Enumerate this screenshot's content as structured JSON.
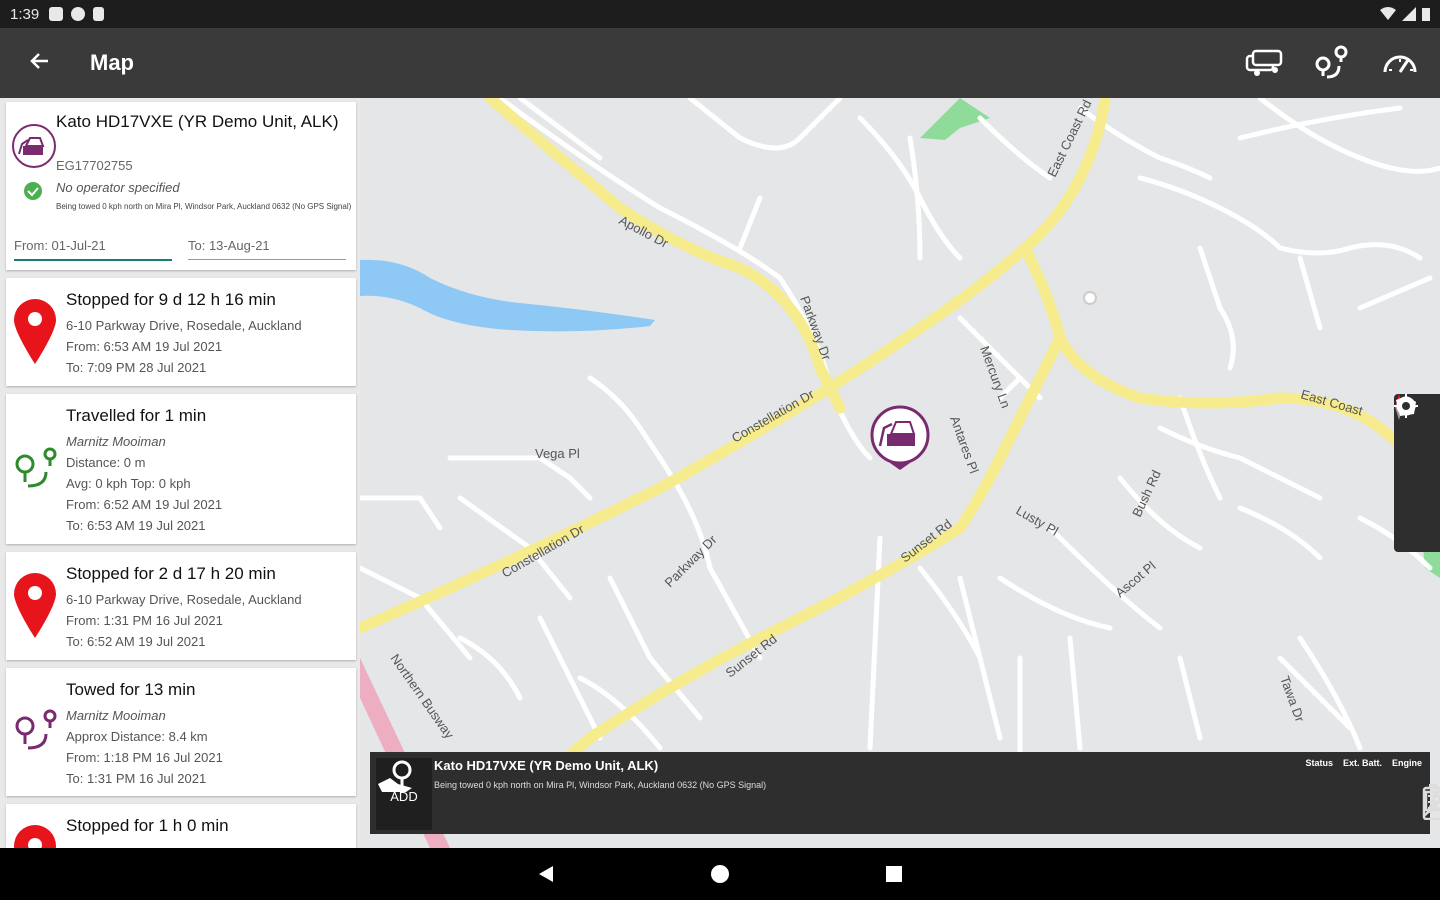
{
  "status_bar": {
    "time": "1:39",
    "icons": [
      "notification-icon",
      "chat-icon",
      "sd-card-icon",
      "wifi-icon",
      "signal-icon",
      "battery-icon"
    ]
  },
  "app_bar": {
    "title": "Map",
    "actions": [
      "vehicles-icon",
      "route-icon",
      "dashboard-icon"
    ]
  },
  "asset": {
    "name": "Kato HD17VXE (YR Demo Unit, ALK)",
    "serial": "EG17702755",
    "operator": "No operator specified",
    "location": "Being towed 0 kph north on Mira Pl, Windsor Park, Auckland 0632 (No GPS Signal)",
    "from": "From: 01-Jul-21",
    "to": "To: 13-Aug-21"
  },
  "trips": [
    {
      "type": "stopped",
      "title": "Stopped for 9 d 12 h 16 min",
      "lines": [
        "6-10 Parkway Drive, Rosedale, Auckland",
        "From:  6:53 AM 19 Jul 2021",
        "To:      7:09 PM 28 Jul 2021"
      ]
    },
    {
      "type": "travelled",
      "title": "Travelled for 1 min",
      "lines": [
        "Marnitz Mooiman",
        "Distance: 0 m",
        "Avg: 0 kph  Top: 0 kph",
        "From:  6:52 AM 19 Jul 2021",
        "To:      6:53 AM 19 Jul 2021"
      ]
    },
    {
      "type": "stopped",
      "title": "Stopped for 2 d 17 h 20 min",
      "lines": [
        "6-10 Parkway Drive, Rosedale, Auckland",
        "From:  1:31 PM 16 Jul 2021",
        "To:      6:52 AM 19 Jul 2021"
      ]
    },
    {
      "type": "towed",
      "title": "Towed for 13 min",
      "lines": [
        "Marnitz Mooiman",
        "Approx Distance: 8.4 km",
        "From:  1:18 PM 16 Jul 2021",
        "To:      1:31 PM 16 Jul 2021"
      ]
    },
    {
      "type": "stopped",
      "title": "Stopped for 1 h 0 min",
      "lines": []
    }
  ],
  "map": {
    "streets": [
      "Apollo Dr",
      "Constellation Dr",
      "Constellation Dr",
      "East Coast Rd",
      "East Coast",
      "Vega Pl",
      "Sunset Rd",
      "Sunset Rd",
      "Parkway Dr",
      "Lusty Pl",
      "Ascot Pl",
      "Mercury Ln",
      "Antares Pl",
      "Bush Rd",
      "Northern Busway",
      "Parkway Dr",
      "Tawa Dr"
    ],
    "road_colors": {
      "major": "#f6ec8e",
      "minor": "#ffffff",
      "water": "#8ec8f5",
      "busway": "#f0a0b8",
      "park": "#8fdc9a"
    },
    "map_tools": [
      "layers-icon",
      "compass-icon",
      "locate-icon",
      "geofence-icon"
    ]
  },
  "bottom_bar": {
    "add_label": "ADD",
    "asset_name": "Kato HD17VXE (YR Demo Unit, ALK)",
    "asset_location": "Being towed 0 kph north on Mira Pl, Windsor Park, Auckland 0632 (No GPS Signal)",
    "column_labels": [
      "Status",
      "Ext. Batt.",
      "Engine"
    ]
  },
  "nav_bar": [
    "back-icon",
    "home-icon",
    "recents-icon"
  ]
}
